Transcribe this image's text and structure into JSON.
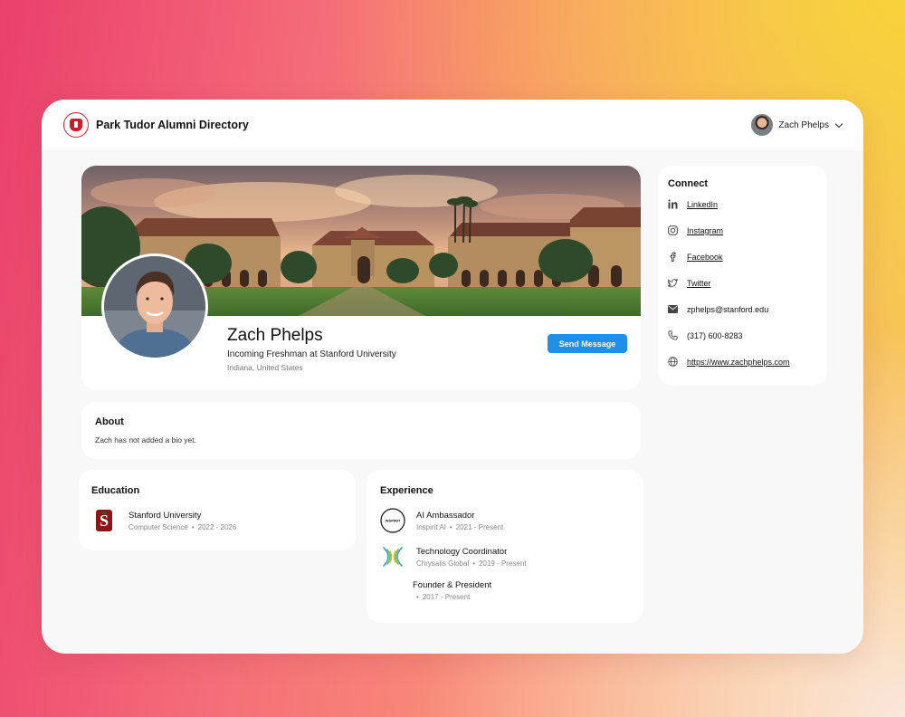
{
  "header": {
    "app_title": "Park Tudor Alumni Directory",
    "user_name": "Zach Phelps"
  },
  "profile": {
    "name": "Zach Phelps",
    "headline": "Incoming Freshman at Stanford University",
    "location": "Indiana, United States",
    "send_message_label": "Send Message"
  },
  "about": {
    "title": "About",
    "text": "Zach has not added a bio yet."
  },
  "education": {
    "title": "Education",
    "items": [
      {
        "school": "Stanford University",
        "field": "Computer Science",
        "years": "2022 - 2026"
      }
    ]
  },
  "experience": {
    "title": "Experience",
    "items": [
      {
        "role": "AI Ambassador",
        "org": "Inspirit AI",
        "years": "2021 - Present",
        "logo_text": "INSPIRIT"
      },
      {
        "role": "Technology Coordinator",
        "org": "Chrysalis Global",
        "years": "2019 - Present"
      },
      {
        "role": "Founder & President",
        "org": "",
        "years": "2017 - Present"
      }
    ]
  },
  "connect": {
    "title": "Connect",
    "items": [
      {
        "icon": "linkedin-icon",
        "label": "LinkedIn"
      },
      {
        "icon": "instagram-icon",
        "label": "Instagram"
      },
      {
        "icon": "facebook-icon",
        "label": "Facebook"
      },
      {
        "icon": "twitter-icon",
        "label": "Twitter"
      },
      {
        "icon": "mail-icon",
        "label": "zphelps@stanford.edu"
      },
      {
        "icon": "phone-icon",
        "label": "(317) 600-8283"
      },
      {
        "icon": "globe-icon",
        "label": "https://www.zachphelps.com"
      }
    ]
  },
  "colors": {
    "accent": "#1f8fe8",
    "logo_red": "#c8202b",
    "stanford_red": "#8c1515"
  }
}
